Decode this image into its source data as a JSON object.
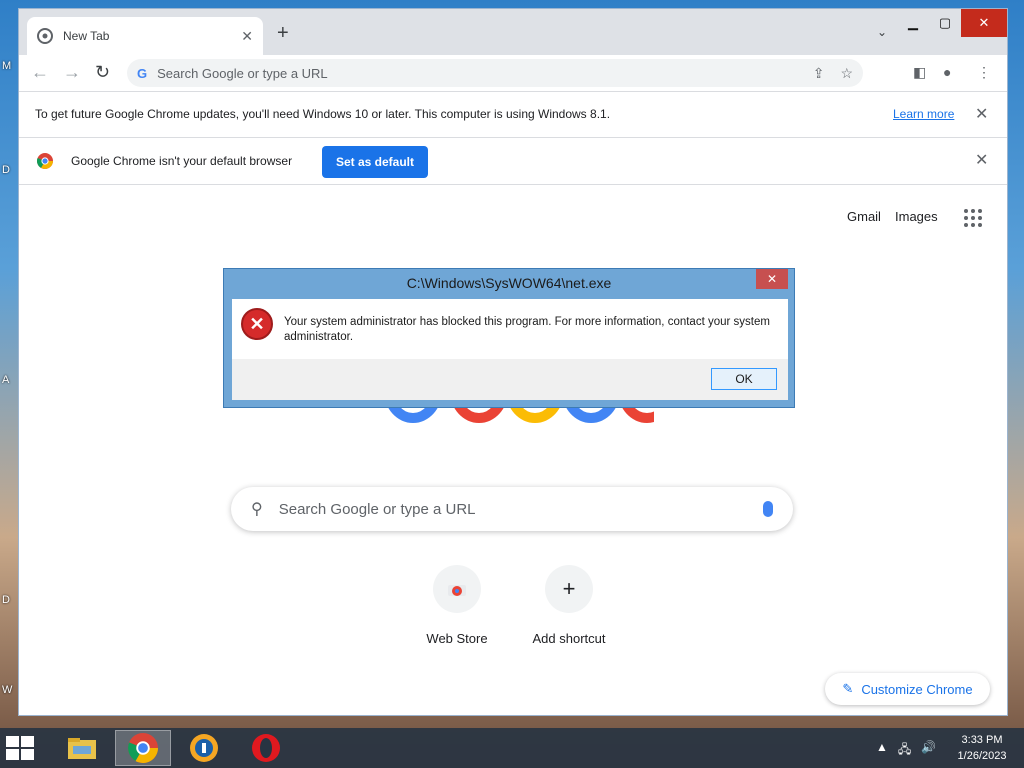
{
  "desktop": {
    "edge_letters": [
      "M",
      "D",
      "A",
      "D",
      "W"
    ]
  },
  "browser": {
    "tab": {
      "title": "New Tab"
    },
    "omnibox": {
      "placeholder": "Search Google or type a URL"
    },
    "infobar_update": {
      "text": "To get future Google Chrome updates, you'll need Windows 10 or later. This computer is using Windows 8.1.",
      "link": "Learn more"
    },
    "infobar_default": {
      "text": "Google Chrome isn't your default browser",
      "button": "Set as default"
    },
    "ntp": {
      "header_links": [
        "Gmail",
        "Images"
      ],
      "search_placeholder": "Search Google or type a URL",
      "shortcuts": [
        "Web Store",
        "Add shortcut"
      ],
      "customize_label": "Customize Chrome"
    }
  },
  "dialog": {
    "title": "C:\\Windows\\SysWOW64\\net.exe",
    "message": "Your system administrator has blocked this program. For more information, contact your system administrator.",
    "ok_label": "OK",
    "icon": "error-icon"
  },
  "taskbar": {
    "apps": [
      "file-explorer-icon",
      "chrome-icon",
      "avast-secure-browser-icon",
      "opera-icon"
    ],
    "time": "3:33 PM",
    "date": "1/26/2023"
  },
  "colors": {
    "accent": "#1a73e8",
    "dialog_frame": "#6fa6d6",
    "error_red": "#d52b2b",
    "taskbar": "#283442"
  }
}
